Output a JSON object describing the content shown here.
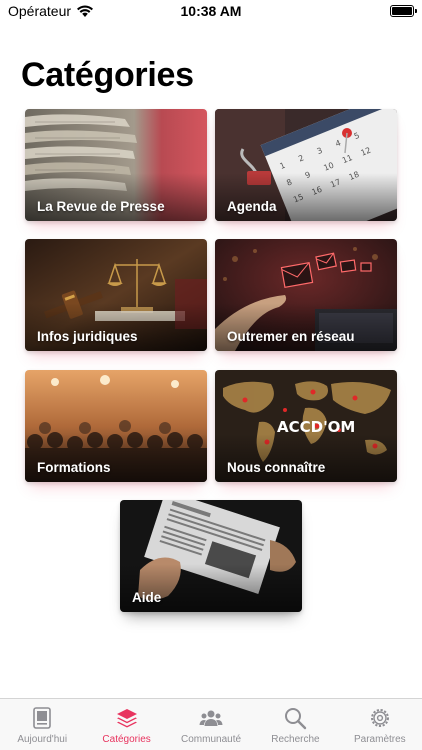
{
  "status_bar": {
    "carrier": "Opérateur",
    "time": "10:38 AM",
    "icons": [
      "wifi-icon",
      "battery-icon"
    ]
  },
  "title": "Catégories",
  "categories": [
    {
      "label": "La Revue de Presse"
    },
    {
      "label": "Agenda"
    },
    {
      "label": "Infos juridiques"
    },
    {
      "label": "Outremer en réseau"
    },
    {
      "label": "Formations"
    },
    {
      "label": "Nous connaître"
    },
    {
      "label": "Aide"
    }
  ],
  "map_overlay_text": "ACCD'OM",
  "tabs": [
    {
      "label": "Aujourd'hui",
      "icon": "newspaper-icon",
      "active": false
    },
    {
      "label": "Catégories",
      "icon": "layers-icon",
      "active": true
    },
    {
      "label": "Communauté",
      "icon": "people-icon",
      "active": false
    },
    {
      "label": "Recherche",
      "icon": "search-icon",
      "active": false
    },
    {
      "label": "Paramètres",
      "icon": "gear-icon",
      "active": false
    }
  ],
  "colors": {
    "accent": "#e8345f",
    "inactive_tab": "#8e8e93"
  }
}
